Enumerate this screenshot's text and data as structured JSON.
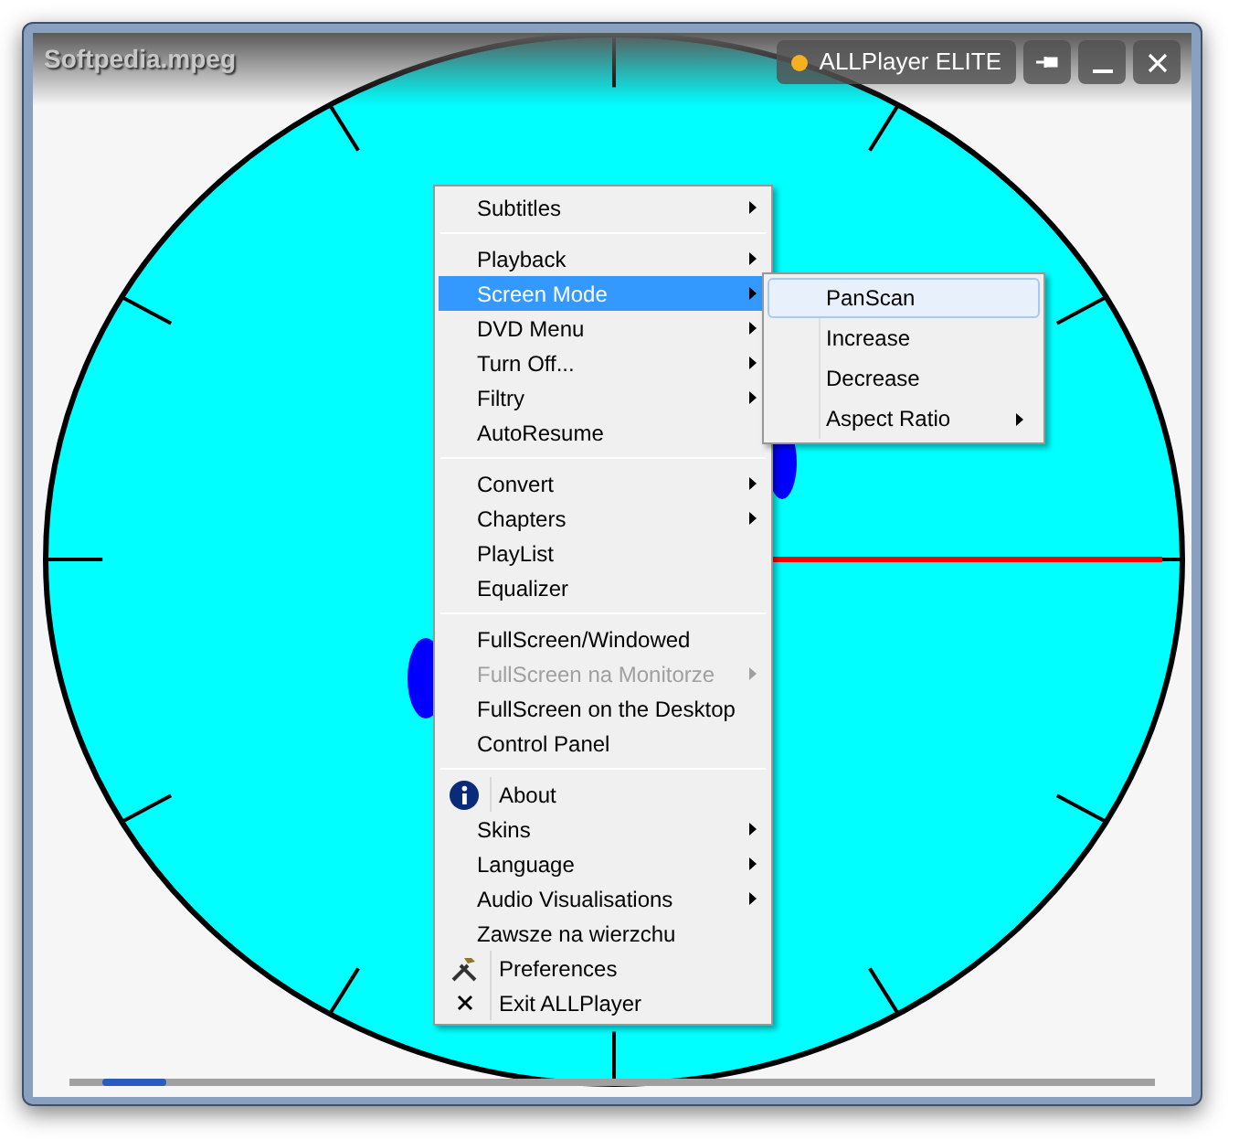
{
  "window": {
    "title": "Softpedia.mpeg",
    "app_badge": "ALLPlayer ELITE"
  },
  "seek_bar": {
    "level": 0.03
  },
  "menu": {
    "groups": [
      [
        {
          "label": "Subtitles",
          "submenu": true,
          "disabled": false,
          "selected": false,
          "kind": "text"
        }
      ],
      [
        {
          "label": "Playback",
          "submenu": true,
          "disabled": false,
          "selected": false,
          "kind": "text"
        },
        {
          "label": "Screen Mode",
          "submenu": true,
          "disabled": false,
          "selected": true,
          "kind": "text"
        },
        {
          "label": "DVD Menu",
          "submenu": true,
          "disabled": false,
          "selected": false,
          "kind": "text"
        },
        {
          "label": "Turn Off...",
          "submenu": true,
          "disabled": false,
          "selected": false,
          "kind": "text"
        },
        {
          "label": "Filtry",
          "submenu": true,
          "disabled": false,
          "selected": false,
          "kind": "text"
        },
        {
          "label": "AutoResume",
          "submenu": false,
          "disabled": false,
          "selected": false,
          "kind": "text"
        }
      ],
      [
        {
          "label": "Convert",
          "submenu": true,
          "disabled": false,
          "selected": false,
          "kind": "text"
        },
        {
          "label": "Chapters",
          "submenu": true,
          "disabled": false,
          "selected": false,
          "kind": "text"
        },
        {
          "label": "PlayList",
          "submenu": false,
          "disabled": false,
          "selected": false,
          "kind": "text"
        },
        {
          "label": "Equalizer",
          "submenu": false,
          "disabled": false,
          "selected": false,
          "kind": "text"
        }
      ],
      [
        {
          "label": "FullScreen/Windowed",
          "submenu": false,
          "disabled": false,
          "selected": false,
          "kind": "text"
        },
        {
          "label": "FullScreen na Monitorze",
          "submenu": true,
          "disabled": true,
          "selected": false,
          "kind": "text"
        },
        {
          "label": "FullScreen on the Desktop",
          "submenu": false,
          "disabled": false,
          "selected": false,
          "kind": "text"
        },
        {
          "label": "Control Panel",
          "submenu": false,
          "disabled": false,
          "selected": false,
          "kind": "text"
        }
      ],
      [
        {
          "label": "About",
          "submenu": false,
          "disabled": false,
          "selected": false,
          "kind": "info"
        },
        {
          "label": "Skins",
          "submenu": true,
          "disabled": false,
          "selected": false,
          "kind": "text"
        },
        {
          "label": "Language",
          "submenu": true,
          "disabled": false,
          "selected": false,
          "kind": "text"
        },
        {
          "label": "Audio Visualisations",
          "submenu": true,
          "disabled": false,
          "selected": false,
          "kind": "text"
        },
        {
          "label": "Zawsze na wierzchu",
          "submenu": false,
          "disabled": false,
          "selected": false,
          "kind": "text"
        },
        {
          "label": "Preferences",
          "submenu": false,
          "disabled": false,
          "selected": false,
          "kind": "tools"
        },
        {
          "label": "Exit ALLPlayer",
          "submenu": false,
          "disabled": false,
          "selected": false,
          "kind": "cross"
        }
      ]
    ]
  },
  "submenu": {
    "items": [
      {
        "label": "PanScan",
        "submenu": false,
        "selected": true
      },
      {
        "label": "Increase",
        "submenu": false,
        "selected": false
      },
      {
        "label": "Decrease",
        "submenu": false,
        "selected": false
      },
      {
        "label": "Aspect Ratio",
        "submenu": true,
        "selected": false
      }
    ]
  }
}
